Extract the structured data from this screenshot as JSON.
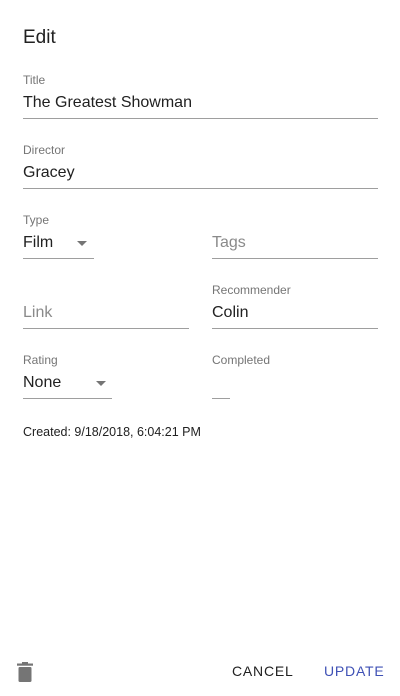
{
  "dialog": {
    "title": "Edit"
  },
  "form": {
    "title": {
      "label": "Title",
      "value": "The Greatest Showman"
    },
    "director": {
      "label": "Director",
      "value": "Gracey"
    },
    "type": {
      "label": "Type",
      "value": "Film"
    },
    "tags": {
      "placeholder": "Tags"
    },
    "link": {
      "placeholder": "Link"
    },
    "recommender": {
      "label": "Recommender",
      "value": "Colin"
    },
    "rating": {
      "label": "Rating",
      "value": "None"
    },
    "completed": {
      "label": "Completed",
      "value": ""
    }
  },
  "created_text": "Created: 9/18/2018, 6:04:21 PM",
  "footer": {
    "delete_icon": "trash-icon",
    "cancel_label": "CANCEL",
    "update_label": "UPDATE"
  },
  "colors": {
    "accent": "#3f51b5",
    "text": "#212121",
    "label": "#757575"
  }
}
